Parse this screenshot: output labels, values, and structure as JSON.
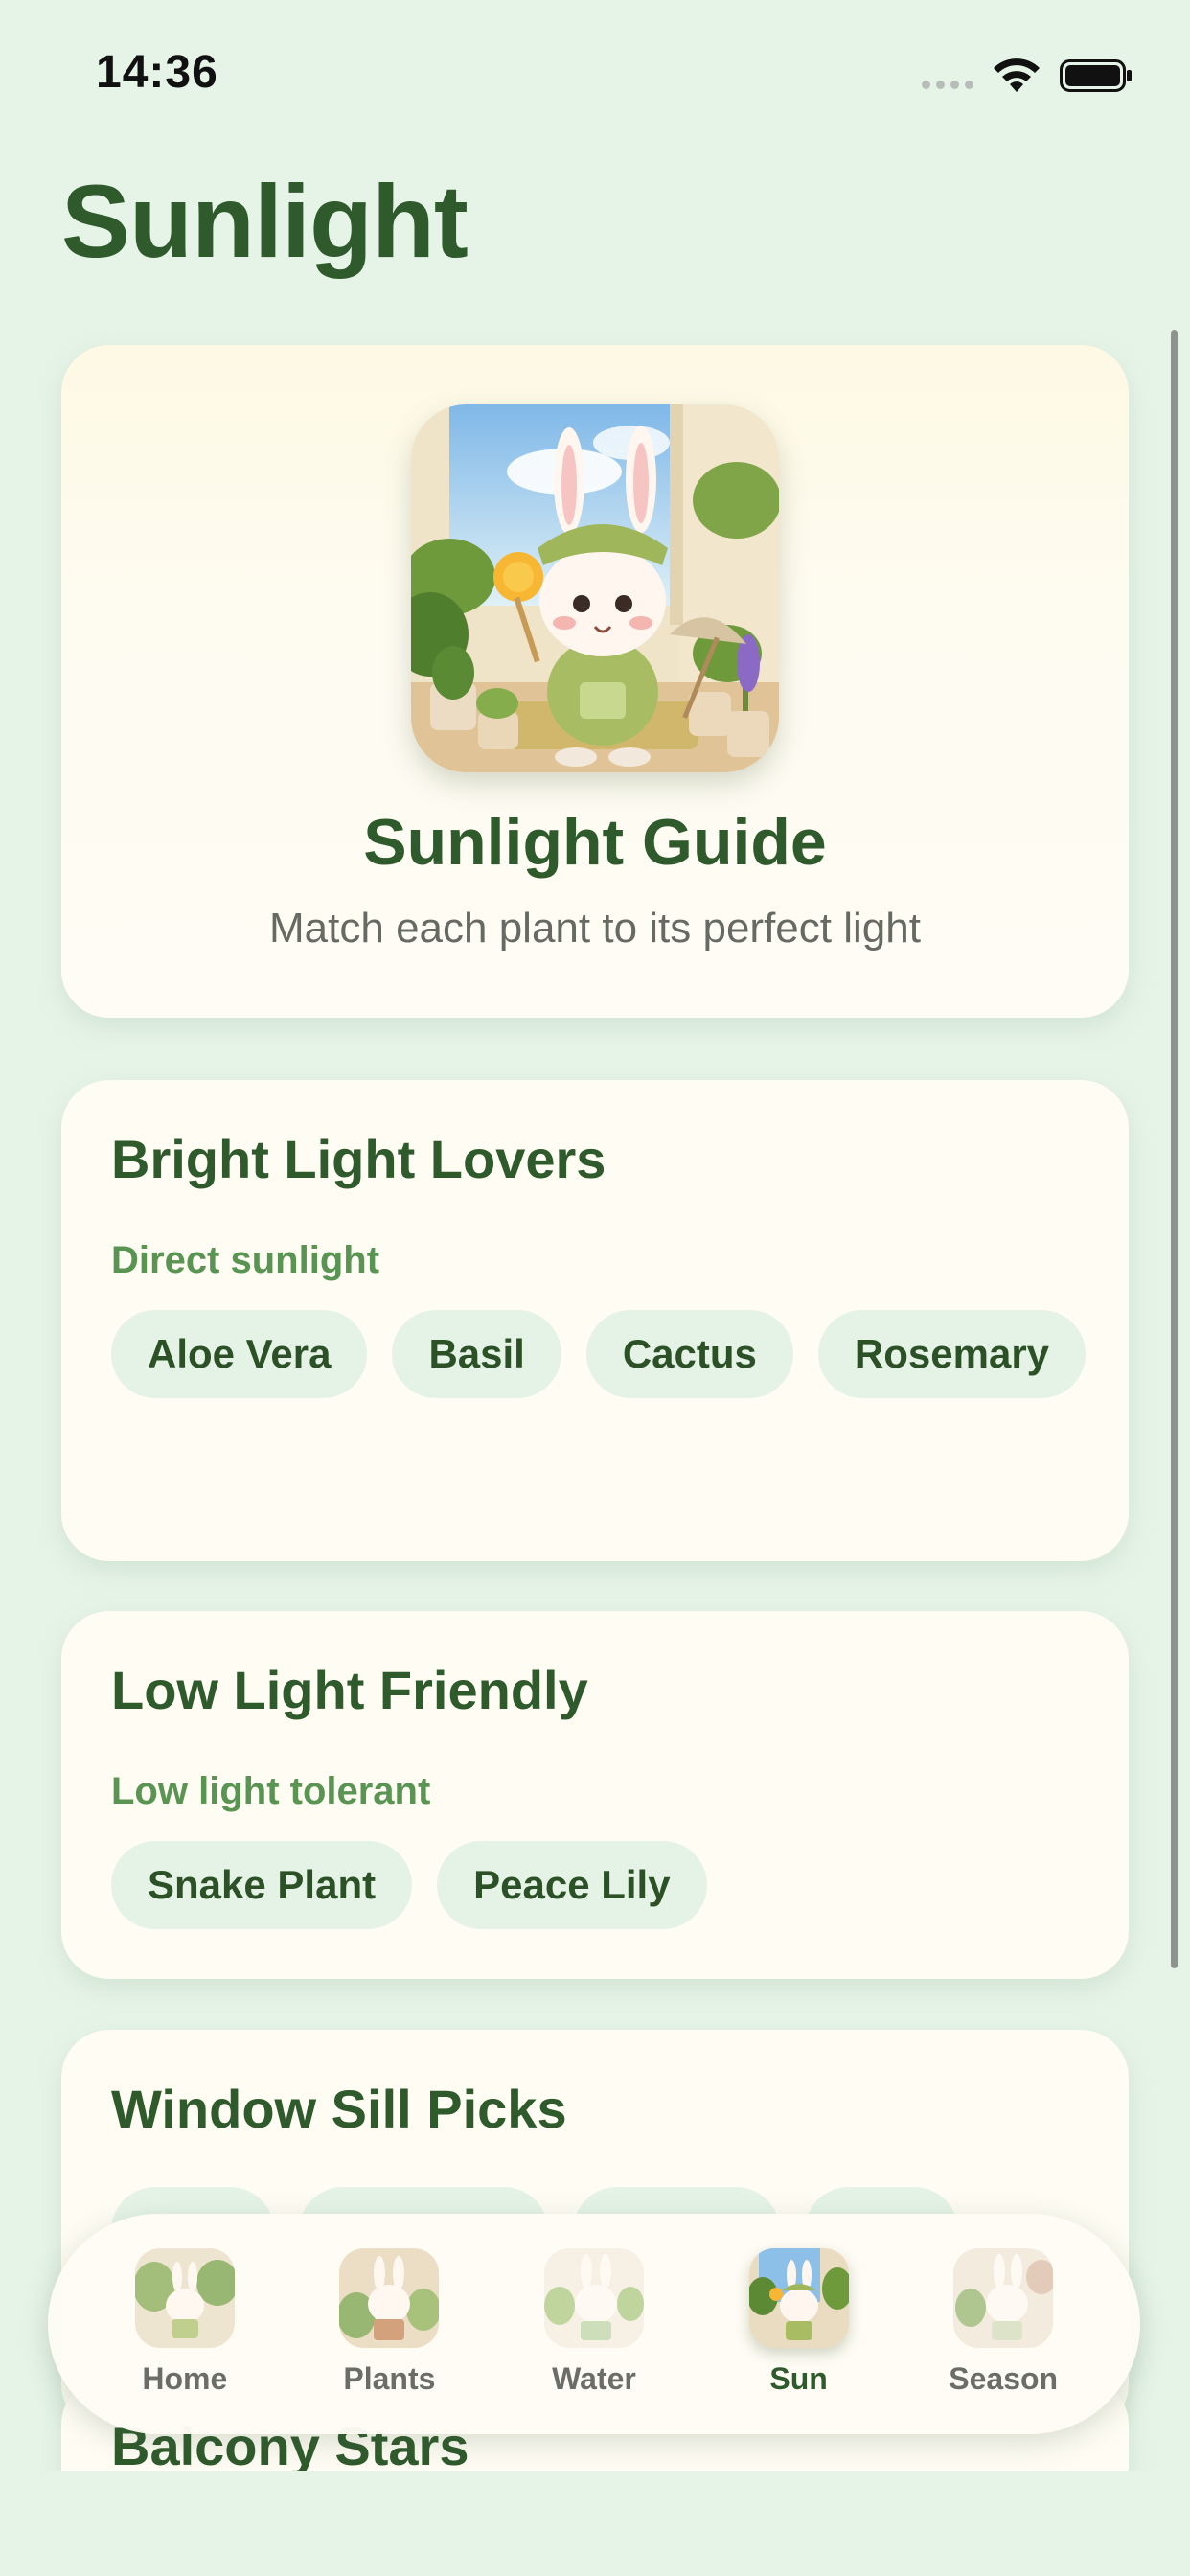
{
  "status_bar": {
    "time": "14:36"
  },
  "header": {
    "title": "Sunlight"
  },
  "hero": {
    "title": "Sunlight Guide",
    "subtitle": "Match each plant to its perfect light"
  },
  "sections": [
    {
      "title": "Bright Light Lovers",
      "subtitle": "Direct sunlight",
      "plants": [
        "Aloe Vera",
        "Basil",
        "Cactus",
        "Rosemary"
      ]
    },
    {
      "title": "Low Light Friendly",
      "subtitle": "Low light tolerant",
      "plants": [
        "Snake Plant",
        "Peace Lily"
      ]
    },
    {
      "title": "Window Sill Picks"
    },
    {
      "title": "Balcony Stars"
    }
  ],
  "tab_bar": {
    "tabs": [
      {
        "label": "Home",
        "icon": "home-bunny-icon"
      },
      {
        "label": "Plants",
        "icon": "plants-bunny-icon"
      },
      {
        "label": "Water",
        "icon": "water-bunny-icon"
      },
      {
        "label": "Sun",
        "icon": "sun-bunny-icon"
      },
      {
        "label": "Season",
        "icon": "season-bunny-icon"
      }
    ],
    "active": "Sun"
  },
  "colors": {
    "background": "#e6f4e8",
    "card": "#fefcf3",
    "title_green": "#2f5a2c",
    "accent_green": "#5a9453",
    "chip_bg": "#e5f3e6"
  }
}
